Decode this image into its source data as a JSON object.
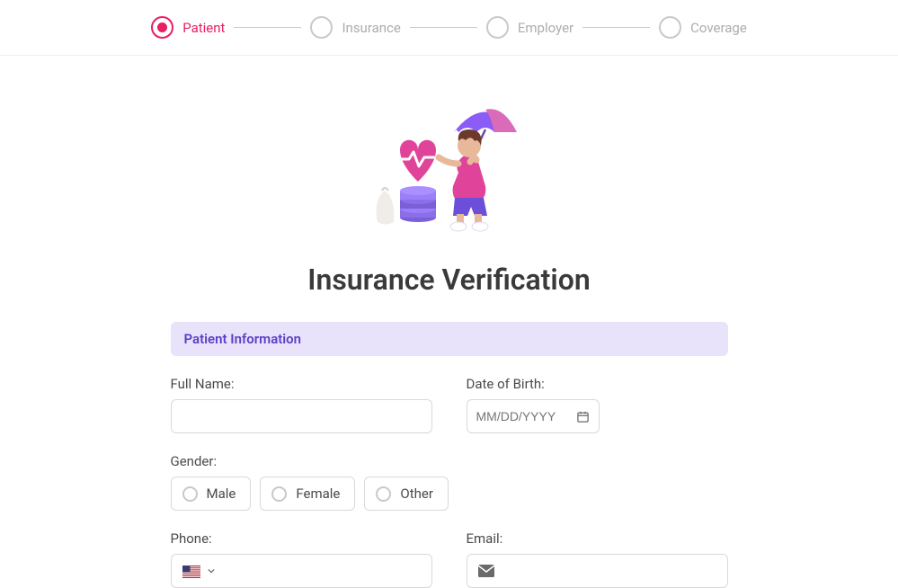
{
  "stepper": {
    "steps": [
      {
        "label": "Patient",
        "active": true
      },
      {
        "label": "Insurance",
        "active": false
      },
      {
        "label": "Employer",
        "active": false
      },
      {
        "label": "Coverage",
        "active": false
      }
    ]
  },
  "page": {
    "title": "Insurance Verification"
  },
  "section": {
    "title": "Patient Information"
  },
  "fields": {
    "full_name": {
      "label": "Full Name:",
      "value": ""
    },
    "dob": {
      "label": "Date of Birth:",
      "placeholder": "MM/DD/YYYY",
      "value": ""
    },
    "gender": {
      "label": "Gender:",
      "options": [
        "Male",
        "Female",
        "Other"
      ],
      "value": ""
    },
    "phone": {
      "label": "Phone:",
      "value": ""
    },
    "email": {
      "label": "Email:",
      "value": ""
    }
  },
  "colors": {
    "accent_pink": "#e91e63",
    "banner_bg": "#e8e3fa",
    "banner_fg": "#5b3ec8"
  }
}
